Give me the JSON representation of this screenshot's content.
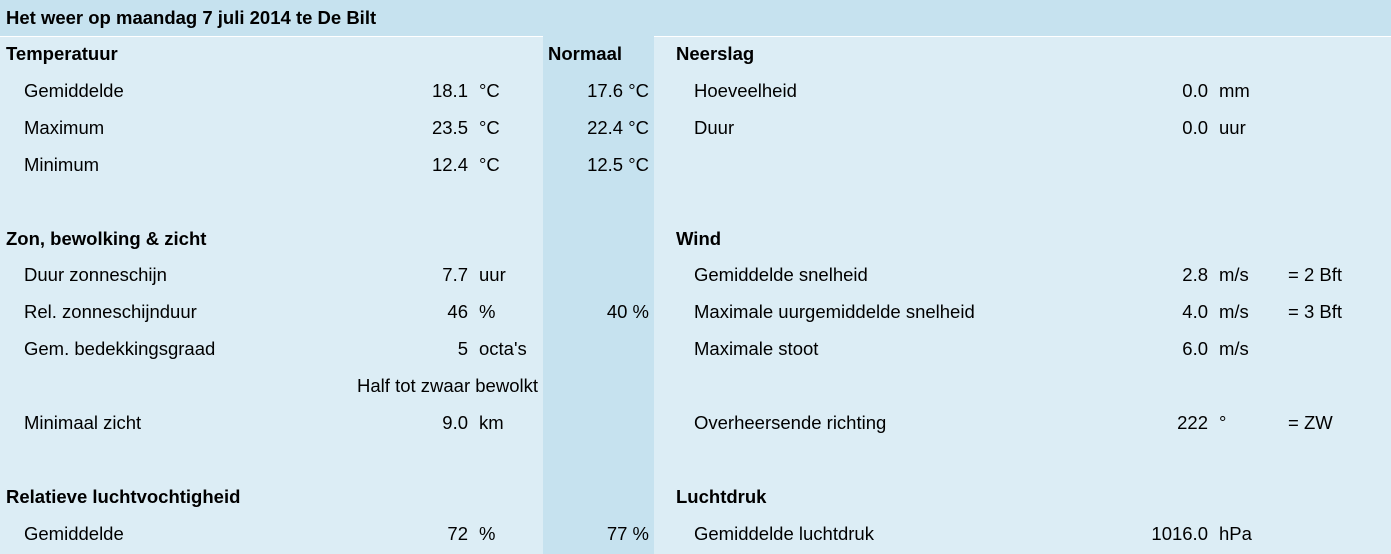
{
  "title": "Het weer op maandag 7 juli 2014 te De Bilt",
  "normaal_header": "Normaal",
  "temperatuur": {
    "heading": "Temperatuur",
    "rows": [
      {
        "label": "Gemiddelde",
        "value": "18.1",
        "unit": "°C",
        "normal": "17.6 °C"
      },
      {
        "label": "Maximum",
        "value": "23.5",
        "unit": "°C",
        "normal": "22.4 °C"
      },
      {
        "label": "Minimum",
        "value": "12.4",
        "unit": "°C",
        "normal": "12.5 °C"
      }
    ]
  },
  "zon": {
    "heading": "Zon, bewolking & zicht",
    "rows": [
      {
        "label": "Duur zonneschijn",
        "value": "7.7",
        "unit": "uur"
      },
      {
        "label": "Rel. zonneschijnduur",
        "value": "46",
        "unit": "%",
        "normal": "40 %"
      },
      {
        "label": "Gem. bedekkingsgraad",
        "value": "5",
        "unit": "octa's"
      },
      {
        "label": "Minimaal zicht",
        "value": "9.0",
        "unit": "km"
      }
    ],
    "bewolking_text": "Half tot zwaar bewolkt"
  },
  "vochtigheid": {
    "heading": "Relatieve luchtvochtigheid",
    "rows": [
      {
        "label": "Gemiddelde",
        "value": "72",
        "unit": "%",
        "normal": "77 %"
      }
    ]
  },
  "neerslag": {
    "heading": "Neerslag",
    "rows": [
      {
        "label": "Hoeveelheid",
        "value": "0.0",
        "unit": "mm"
      },
      {
        "label": "Duur",
        "value": "0.0",
        "unit": "uur"
      }
    ]
  },
  "wind": {
    "heading": "Wind",
    "rows": [
      {
        "label": "Gemiddelde snelheid",
        "value": "2.8",
        "unit": "m/s",
        "extra": "= 2 Bft"
      },
      {
        "label": "Maximale uurgemiddelde snelheid",
        "value": "4.0",
        "unit": "m/s",
        "extra": "= 3 Bft"
      },
      {
        "label": "Maximale stoot",
        "value": "6.0",
        "unit": "m/s"
      },
      {
        "label": "Overheersende richting",
        "value": "222",
        "unit": "°",
        "extra": "= ZW"
      }
    ]
  },
  "luchtdruk": {
    "heading": "Luchtdruk",
    "rows": [
      {
        "label": "Gemiddelde luchtdruk",
        "value": "1016.0",
        "unit": "hPa"
      }
    ]
  }
}
